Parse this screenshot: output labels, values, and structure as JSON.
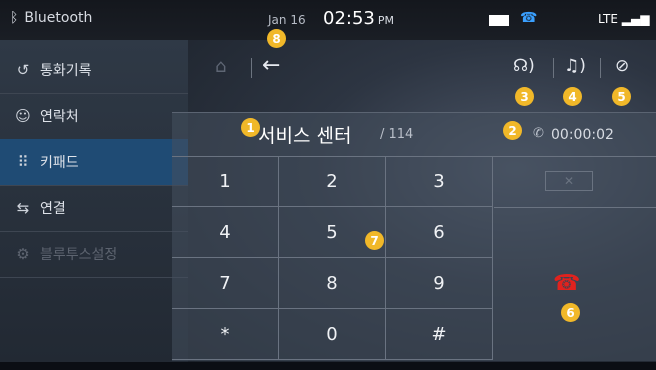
{
  "status_bar": {
    "bt_title": "Bluetooth",
    "date": "Jan 16",
    "time": "02:53",
    "ampm": "PM",
    "network": "LTE"
  },
  "sidebar": {
    "items": [
      {
        "label": "통화기록",
        "icon": "history-icon",
        "state": "normal"
      },
      {
        "label": "연락처",
        "icon": "contacts-icon",
        "state": "normal"
      },
      {
        "label": "키패드",
        "icon": "keypad-icon",
        "state": "active"
      },
      {
        "label": "연결",
        "icon": "transfer-icon",
        "state": "normal"
      },
      {
        "label": "블루투스설정",
        "icon": "settings-icon",
        "state": "disabled"
      }
    ]
  },
  "call": {
    "name": "서비스 센터",
    "number": "/ 114",
    "duration": "00:00:02"
  },
  "keypad": {
    "keys": [
      "1",
      "2",
      "3",
      "4",
      "5",
      "6",
      "7",
      "8",
      "9",
      "*",
      "0",
      "#"
    ]
  },
  "badges": [
    "1",
    "2",
    "3",
    "4",
    "5",
    "6",
    "7",
    "8"
  ],
  "colors": {
    "accent": "#1f4b74",
    "badge": "#f1b829",
    "end_call": "#e0221e"
  }
}
